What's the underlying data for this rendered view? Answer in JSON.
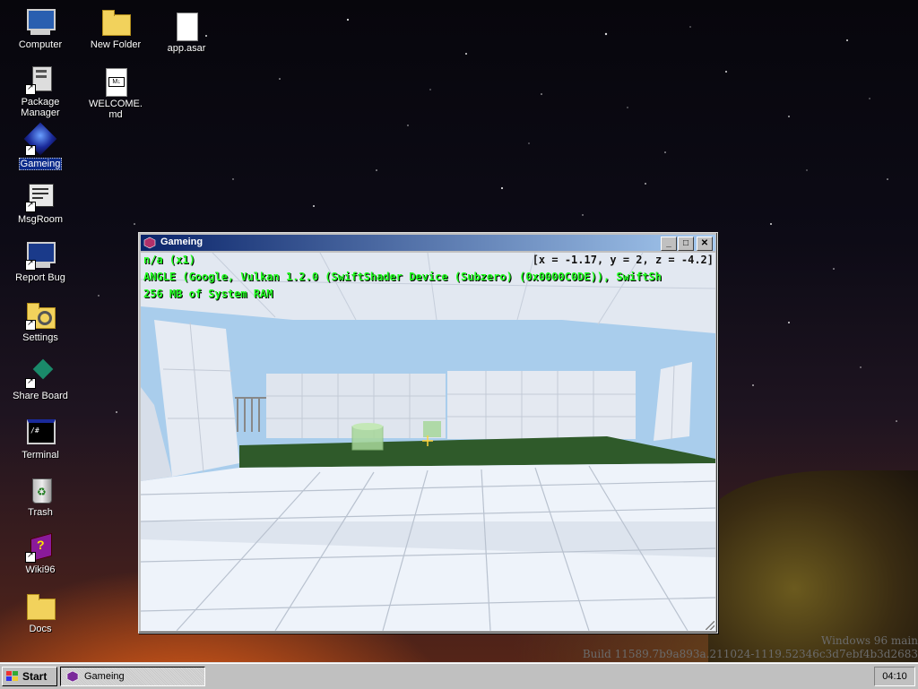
{
  "desktop": {
    "icons": [
      {
        "label": "Computer",
        "icon": "computer-icon"
      },
      {
        "label": "New Folder",
        "icon": "folder-icon"
      },
      {
        "label": "app.asar",
        "icon": "file-icon"
      },
      {
        "label": "Package Manager",
        "icon": "package-manager-icon"
      },
      {
        "label": "WELCOME.md",
        "icon": "markdown-file-icon"
      },
      {
        "label": "Gameing",
        "icon": "game-icon",
        "selected": true
      },
      {
        "label": "MsgRoom",
        "icon": "msgroom-icon"
      },
      {
        "label": "Report Bug",
        "icon": "report-bug-icon"
      },
      {
        "label": "Settings",
        "icon": "settings-icon"
      },
      {
        "label": "Share Board",
        "icon": "share-board-icon"
      },
      {
        "label": "Terminal",
        "icon": "terminal-icon"
      },
      {
        "label": "Trash",
        "icon": "trash-icon"
      },
      {
        "label": "Wiki96",
        "icon": "wiki-icon"
      },
      {
        "label": "Docs",
        "icon": "folder-icon"
      }
    ],
    "watermark": {
      "line1": "Windows 96 main",
      "line2": "Build 11589.7b9a893a.211024-1119.52346c3d7ebf4b3d2683"
    }
  },
  "window": {
    "title": "Gameing",
    "controls": {
      "minimize": "_",
      "maximize": "□",
      "close": "✕"
    },
    "hud": {
      "line1": "n/a (x1)",
      "line2": "ANGLE (Google, Vulkan 1.2.0 (SwiftShader Device (Subzero) (0x0000C0DE)), SwiftSh",
      "line3": "256 MB of System RAM",
      "coords": "[x = -1.17, y = 2, z = -4.2]"
    },
    "colors": {
      "hud_text": "#22ff22",
      "floor": "#eef3fa",
      "grass": "#2f5a2a"
    }
  },
  "taskbar": {
    "start_label": "Start",
    "task_label": "Gameing",
    "clock": "04:10"
  }
}
